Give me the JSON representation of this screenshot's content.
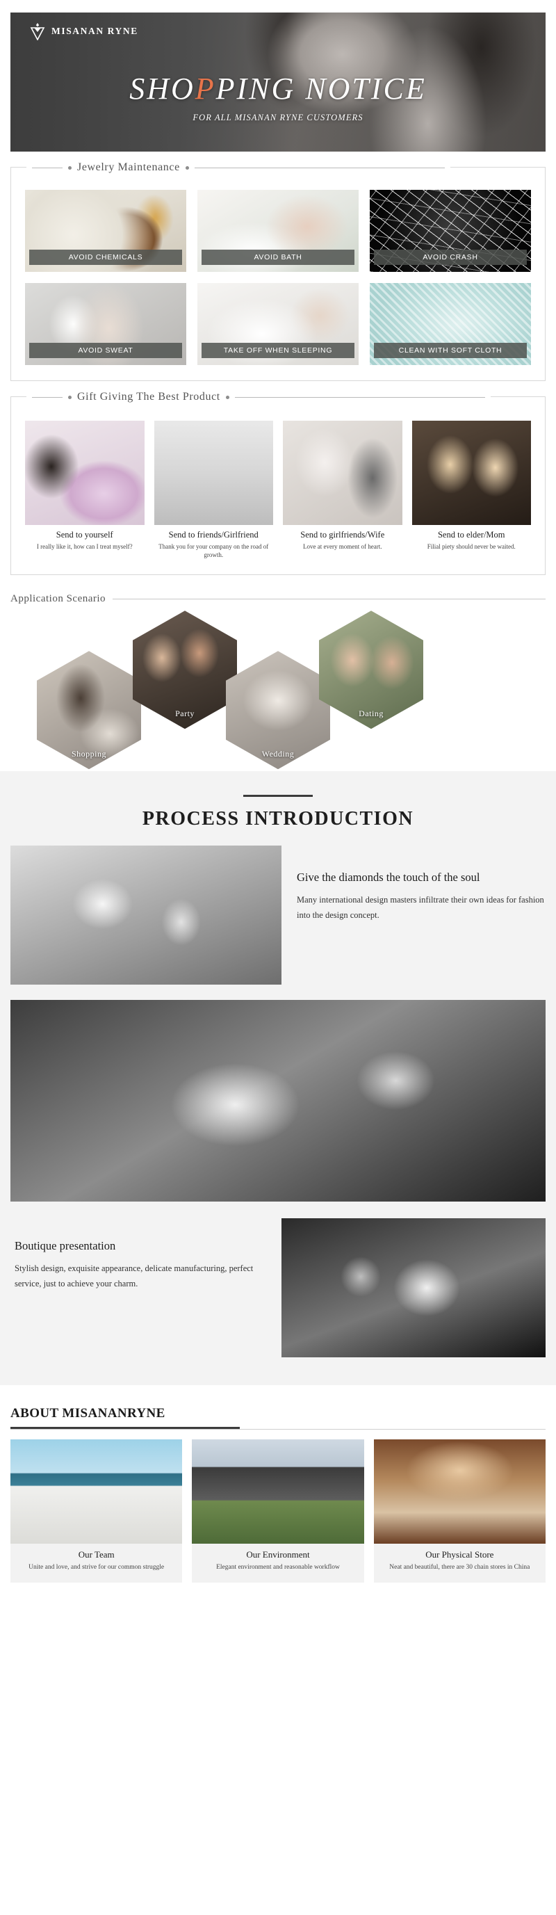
{
  "hero": {
    "brand": "MISANAN RYNE",
    "logo_icon": "diamond-logo-icon",
    "title_part1": "SHO",
    "title_accent": "P",
    "title_part2": "PING ",
    "title_part3": "NOTICE",
    "subtitle": "FOR ALL MISANAN RYNE CUSTOMERS",
    "accent_color": "#e8744a"
  },
  "maintenance": {
    "heading": "Jewelry Maintenance",
    "items": [
      {
        "label": "AVOID CHEMICALS",
        "photo": "perfume-bottle-photo"
      },
      {
        "label": "AVOID BATH",
        "photo": "woman-in-bath-photo"
      },
      {
        "label": "AVOID CRASH",
        "photo": "shattered-glass-photo"
      },
      {
        "label": "AVOID SWEAT",
        "photo": "woman-wiping-sweat-photo"
      },
      {
        "label": "TAKE OFF WHEN SLEEPING",
        "photo": "woman-sleeping-photo"
      },
      {
        "label": "CLEAN WITH SOFT CLOTH",
        "photo": "soft-cloth-photo"
      }
    ]
  },
  "gift": {
    "heading": "Gift Giving The Best Product",
    "items": [
      {
        "title": "Send to yourself",
        "desc": "I really like it, how can I treat myself?",
        "photo": "woman-with-flowers-photo"
      },
      {
        "title": "Send to friends/Girlfriend",
        "desc": "Thank you for your company on the road of growth.",
        "photo": "two-women-walking-photo"
      },
      {
        "title": "Send to girlfriends/Wife",
        "desc": "Love at every moment of heart.",
        "photo": "bride-and-groom-photo"
      },
      {
        "title": "Send to elder/Mom",
        "desc": "Filial piety should never be waited.",
        "photo": "mother-and-daughter-photo"
      }
    ]
  },
  "scenario": {
    "heading": "Application Scenario",
    "items": [
      {
        "label": "Shopping",
        "photo": "shopping-photo"
      },
      {
        "label": "Party",
        "photo": "party-photo"
      },
      {
        "label": "Wedding",
        "photo": "wedding-photo"
      },
      {
        "label": "Dating",
        "photo": "dating-photo"
      }
    ]
  },
  "process": {
    "title": "PROCESS INTRODUCTION",
    "block1": {
      "heading": "Give the diamonds the touch of the soul",
      "body": "Many international design masters infiltrate their own ideas for fashion into the design concept.",
      "photo": "design-meeting-photo"
    },
    "wide_photo": "craftsman-setting-diamond-photo",
    "block2": {
      "heading": "Boutique presentation",
      "body": "Stylish design, exquisite appearance, delicate manufacturing, perfect service, just to achieve your charm.",
      "photo": "ring-polishing-photo"
    }
  },
  "about": {
    "title": "ABOUT MISANANRYNE",
    "items": [
      {
        "heading": "Our Team",
        "desc": "Unite and love, and strive for our common struggle",
        "photo": "team-group-photo"
      },
      {
        "heading": "Our Environment",
        "desc": "Elegant environment and reasonable workflow",
        "photo": "office-building-photo"
      },
      {
        "heading": "Our Physical Store",
        "desc": "Neat and beautiful, there are 30 chain stores in China",
        "photo": "jewelry-store-photo"
      }
    ]
  }
}
